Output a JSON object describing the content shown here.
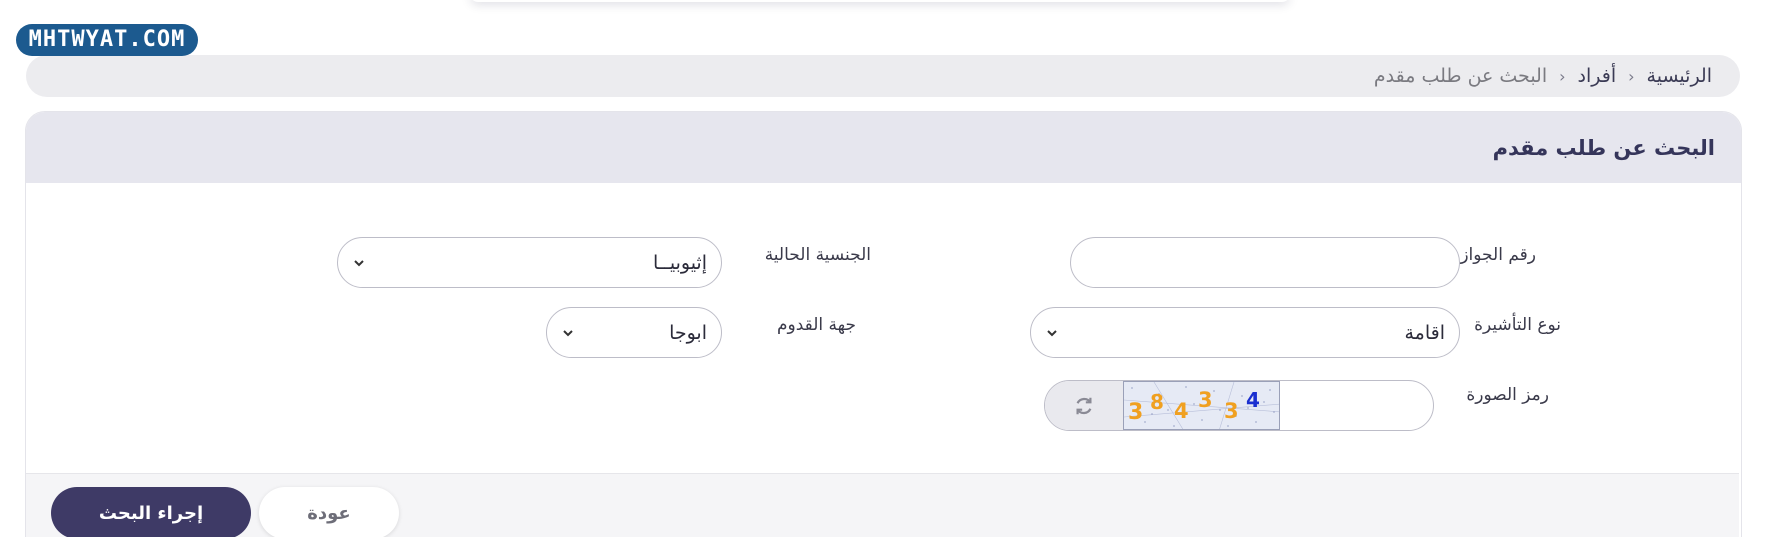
{
  "watermark": "MHTWYAT.COM",
  "breadcrumb": {
    "home": "الرئيسية",
    "individuals": "أفراد",
    "current": "البحث عن طلب مقدم"
  },
  "card": {
    "title": "البحث عن طلب مقدم"
  },
  "form": {
    "passport_label": "رقم الجواز",
    "passport_value": "",
    "nationality_label": "الجنسية الحالية",
    "nationality_value": "إثيوبيــا",
    "visa_type_label": "نوع التأشيرة",
    "visa_type_value": "اقامة",
    "arrival_label": "جهة القدوم",
    "arrival_value": "ابوجا",
    "captcha_label": "رمز الصورة",
    "captcha_code": "384334"
  },
  "buttons": {
    "back": "عودة",
    "search": "إجراء البحث"
  },
  "colors": {
    "primary_button": "#3e3a66",
    "header_bg": "#e6e6ee",
    "captcha_orange": "#f0a020",
    "captcha_blue": "#1a2fd0"
  },
  "icons": {
    "refresh": "refresh-icon",
    "chevron": "chevron-down-icon"
  }
}
